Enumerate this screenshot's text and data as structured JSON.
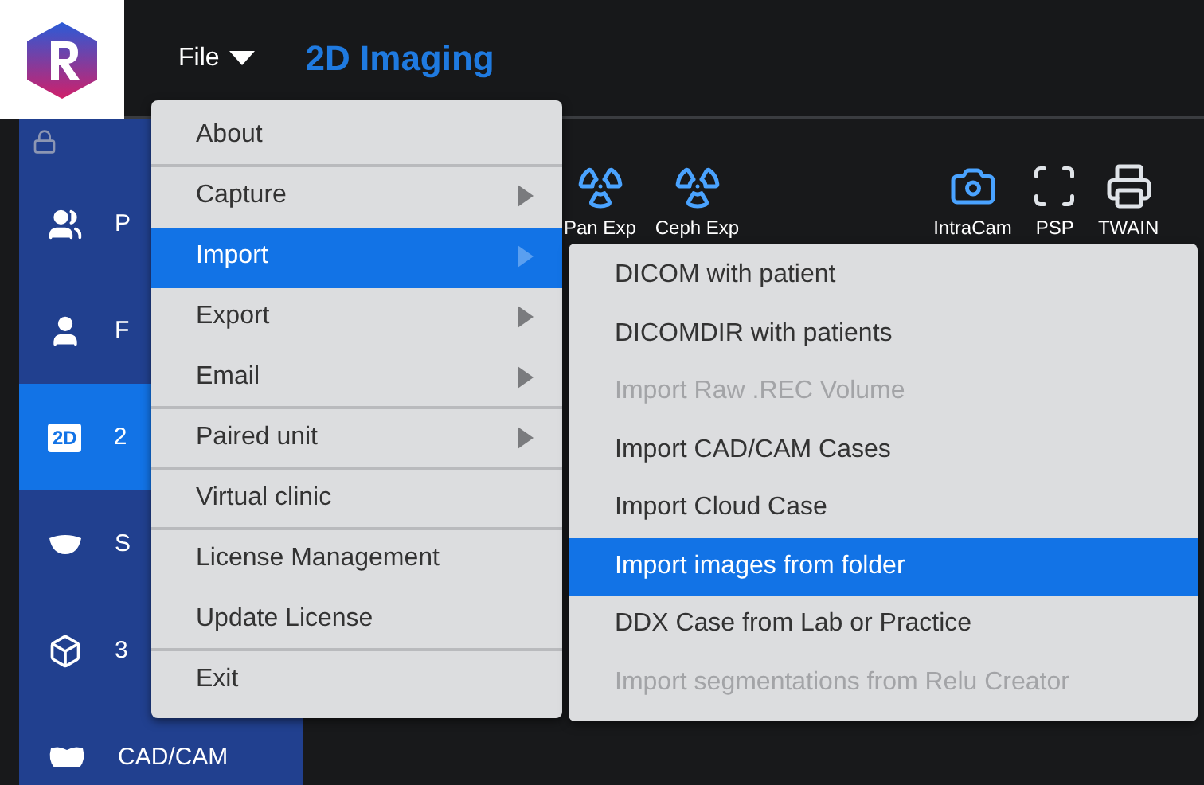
{
  "header": {
    "menu_label": "File",
    "app_title": "2D Imaging"
  },
  "sidebar": {
    "items": [
      {
        "kind": "patients",
        "label": "P",
        "selected": false
      },
      {
        "kind": "file",
        "label": "F",
        "selected": false
      },
      {
        "kind": "flat",
        "label": "2",
        "badge": "2D",
        "selected": true
      },
      {
        "kind": "smile",
        "label": "S",
        "selected": false
      },
      {
        "kind": "volume",
        "label": "3",
        "selected": false
      },
      {
        "kind": "cadcam",
        "label": "CAD/CAM",
        "selected": false
      }
    ]
  },
  "toolbar": [
    {
      "kind": "pan",
      "label": "Pan Exp"
    },
    {
      "kind": "ceph",
      "label": "Ceph Exp"
    },
    {
      "kind": "intracam",
      "label": "IntraCam"
    },
    {
      "kind": "psp",
      "label": "PSP"
    },
    {
      "kind": "twain",
      "label": "TWAIN"
    }
  ],
  "file_menu": [
    {
      "label": "About",
      "submenu": false,
      "selected": false,
      "separator_after": true
    },
    {
      "label": "Capture",
      "submenu": true,
      "selected": false,
      "separator_after": false
    },
    {
      "label": "Import",
      "submenu": true,
      "selected": true,
      "separator_after": false
    },
    {
      "label": "Export",
      "submenu": true,
      "selected": false,
      "separator_after": false
    },
    {
      "label": "Email",
      "submenu": true,
      "selected": false,
      "separator_after": true
    },
    {
      "label": "Paired unit",
      "submenu": true,
      "selected": false,
      "separator_after": true
    },
    {
      "label": "Virtual clinic",
      "submenu": false,
      "selected": false,
      "separator_after": true
    },
    {
      "label": "License Management",
      "submenu": false,
      "selected": false,
      "separator_after": false
    },
    {
      "label": "Update License",
      "submenu": false,
      "selected": false,
      "separator_after": true
    },
    {
      "label": "Exit",
      "submenu": false,
      "selected": false,
      "separator_after": false
    }
  ],
  "import_submenu": [
    {
      "label": "DICOM with patient",
      "disabled": false,
      "selected": false
    },
    {
      "label": "DICOMDIR with patients",
      "disabled": false,
      "selected": false
    },
    {
      "label": "Import Raw .REC Volume",
      "disabled": true,
      "selected": false
    },
    {
      "label": "Import CAD/CAM Cases",
      "disabled": false,
      "selected": false
    },
    {
      "label": "Import Cloud Case",
      "disabled": false,
      "selected": false
    },
    {
      "label": "Import images from folder",
      "disabled": false,
      "selected": true
    },
    {
      "label": "DDX Case from Lab or Practice",
      "disabled": false,
      "selected": false
    },
    {
      "label": "Import segmentations from Relu Creator",
      "disabled": true,
      "selected": false
    }
  ]
}
